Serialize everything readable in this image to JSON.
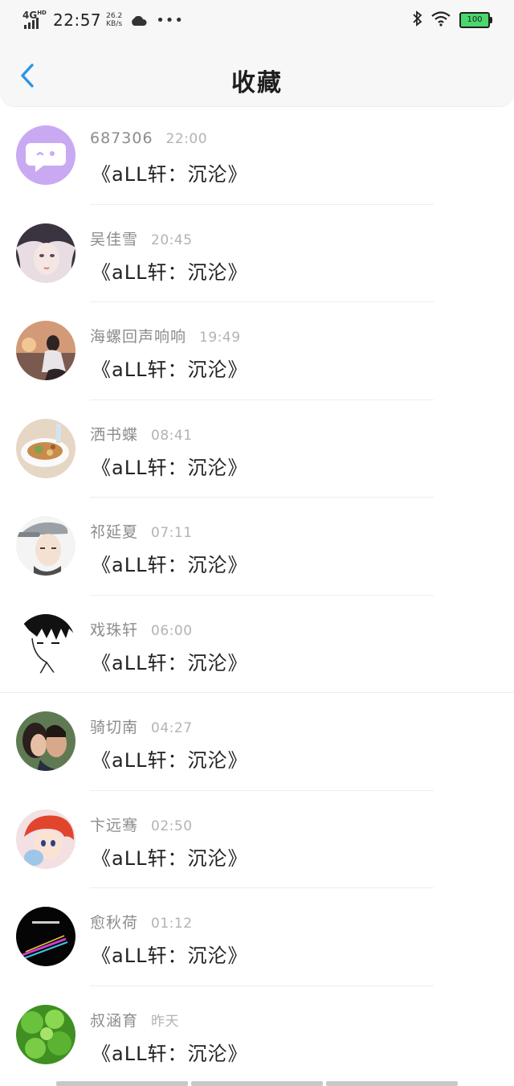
{
  "status_bar": {
    "network": "4G",
    "network_sup": "HD",
    "time": "22:57",
    "speed_value": "26.2",
    "speed_unit": "KB/s",
    "dots": "•••",
    "battery": "100"
  },
  "header": {
    "title": "收藏"
  },
  "items": [
    {
      "sender": "687306",
      "time": "22:00",
      "message": "《aLL轩：沉沦》"
    },
    {
      "sender": "吴佳雪",
      "time": "20:45",
      "message": "《aLL轩：沉沦》"
    },
    {
      "sender": "海螺回声响响",
      "time": "19:49",
      "message": "《aLL轩：沉沦》"
    },
    {
      "sender": "洒书蝶",
      "time": "08:41",
      "message": "《aLL轩：沉沦》"
    },
    {
      "sender": "祁延夏",
      "time": "07:11",
      "message": "《aLL轩：沉沦》"
    },
    {
      "sender": "戏珠轩",
      "time": "06:00",
      "message": "《aLL轩：沉沦》"
    },
    {
      "sender": "骑切南",
      "time": "04:27",
      "message": "《aLL轩：沉沦》"
    },
    {
      "sender": "卞远骞",
      "time": "02:50",
      "message": "《aLL轩：沉沦》"
    },
    {
      "sender": "愈秋荷",
      "time": "01:12",
      "message": "《aLL轩：沉沦》"
    },
    {
      "sender": "叔涵育",
      "time": "昨天",
      "message": "《aLL轩：沉沦》"
    }
  ],
  "colors": {
    "accent": "#2a95e8",
    "battery": "#48d86c",
    "default_avatar": "#c9aaf2"
  },
  "avatar_icons": [
    "chat-bubble-avatar",
    "girl-portrait-avatar",
    "seaside-girl-avatar",
    "food-bowl-avatar",
    "boy-cap-avatar",
    "anime-boy-avatar",
    "couple-kiss-avatar",
    "cartoon-girl-avatar",
    "dark-text-avatar",
    "green-leaves-avatar"
  ]
}
